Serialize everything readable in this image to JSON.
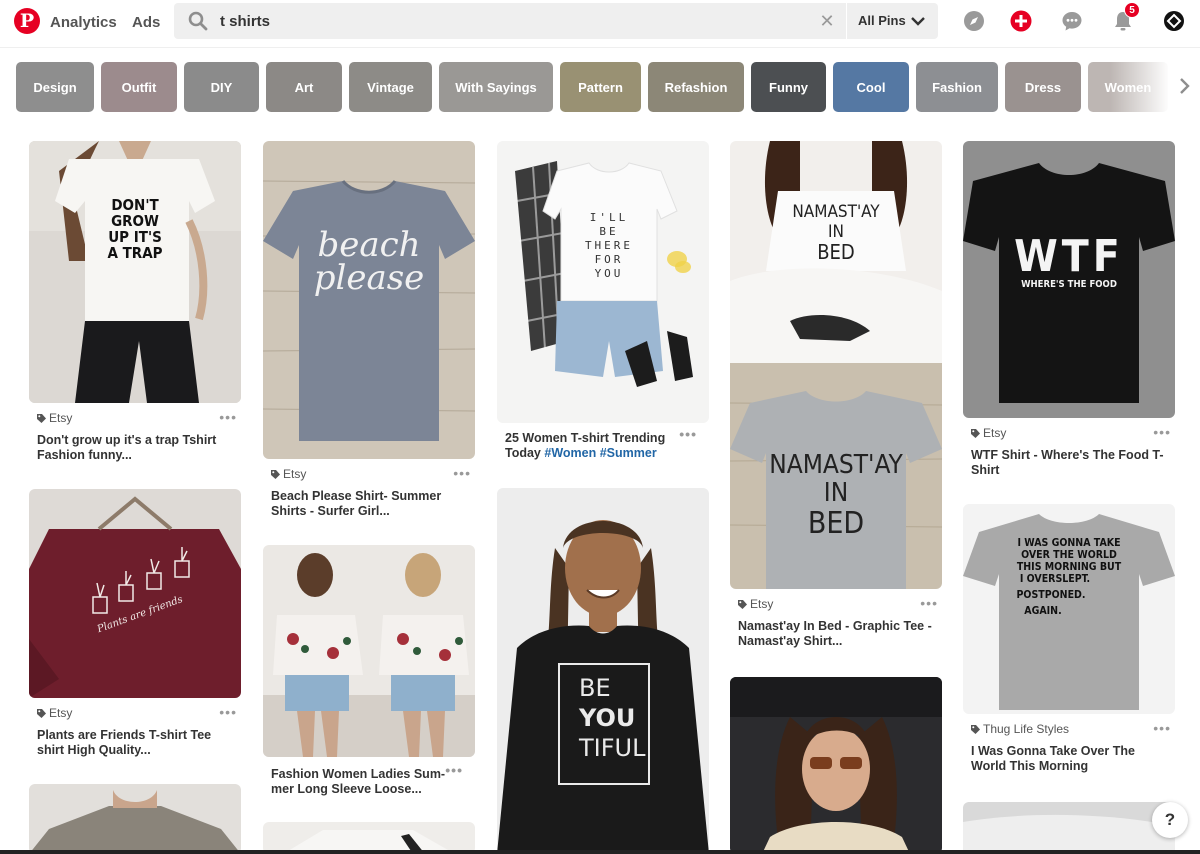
{
  "header": {
    "logo": "P",
    "nav": [
      "Analytics",
      "Ads"
    ],
    "search": {
      "query": "t shirts",
      "scope": "All Pins"
    },
    "notifications_count": "5"
  },
  "guides": [
    {
      "label": "Design",
      "color": "#8e8e8e"
    },
    {
      "label": "Outfit",
      "color": "#9c8b8d"
    },
    {
      "label": "DIY",
      "color": "#8b8b8b"
    },
    {
      "label": "Art",
      "color": "#8c8986"
    },
    {
      "label": "Vintage",
      "color": "#8d8b87"
    },
    {
      "label": "With Sayings",
      "color": "#9a9895"
    },
    {
      "label": "Pattern",
      "color": "#999173"
    },
    {
      "label": "Refashion",
      "color": "#8c8777"
    },
    {
      "label": "Funny",
      "color": "#4c4f52"
    },
    {
      "label": "Cool",
      "color": "#5578a3"
    },
    {
      "label": "Fashion",
      "color": "#8d8f93"
    },
    {
      "label": "Dress",
      "color": "#9a9290"
    },
    {
      "label": "Women",
      "color": "#bdb6b3"
    }
  ],
  "pins": {
    "p1": {
      "shirt_text": "DON'T GROW UP IT'S A TRAP",
      "source": "Etsy",
      "title": "Don't grow up it's a trap Tshirt Fashion funny..."
    },
    "p2": {
      "source": "Etsy",
      "title": "Plants are Friends T-shirt Tee shirt High Quality..."
    },
    "p4": {
      "shirt_text_1": "beach",
      "shirt_text_2": "please",
      "source": "Etsy",
      "title": "Beach Please Shirt- Summer Shirts - Surfer Girl..."
    },
    "p5": {
      "title": "Fashion Women Ladies Sum- mer Long Sleeve Loose..."
    },
    "p7": {
      "shirt_text": [
        "I'LL",
        "BE",
        "THERE",
        "FOR",
        "YOU"
      ],
      "title": "25 Women T-shirt Trending Today",
      "hashtags": "#Women #Summer"
    },
    "p8": {
      "shirt_text": [
        "BE",
        "YOU",
        "TIFUL"
      ]
    },
    "p9": {
      "shirt_text": [
        "NAMAST'AY",
        "IN",
        "BED"
      ],
      "source": "Etsy",
      "title": "Namast'ay In Bed - Graphic Tee - Namast'ay Shirt..."
    },
    "p11": {
      "shirt_text_1": "WTF",
      "shirt_text_2": "WHERE'S THE FOOD",
      "source": "Etsy",
      "title": "WTF Shirt - Where's The Food T-Shirt"
    },
    "p12": {
      "shirt_text": [
        "I WAS GONNA TAKE",
        "OVER THE WORLD",
        "THIS MORNING BUT",
        "I OVERSLEPT.",
        "POSTPONED.",
        "AGAIN."
      ],
      "source": "Thug Life Styles",
      "title": "I Was Gonna Take Over The World This Morning"
    }
  },
  "more_label": "•••",
  "help_label": "?"
}
